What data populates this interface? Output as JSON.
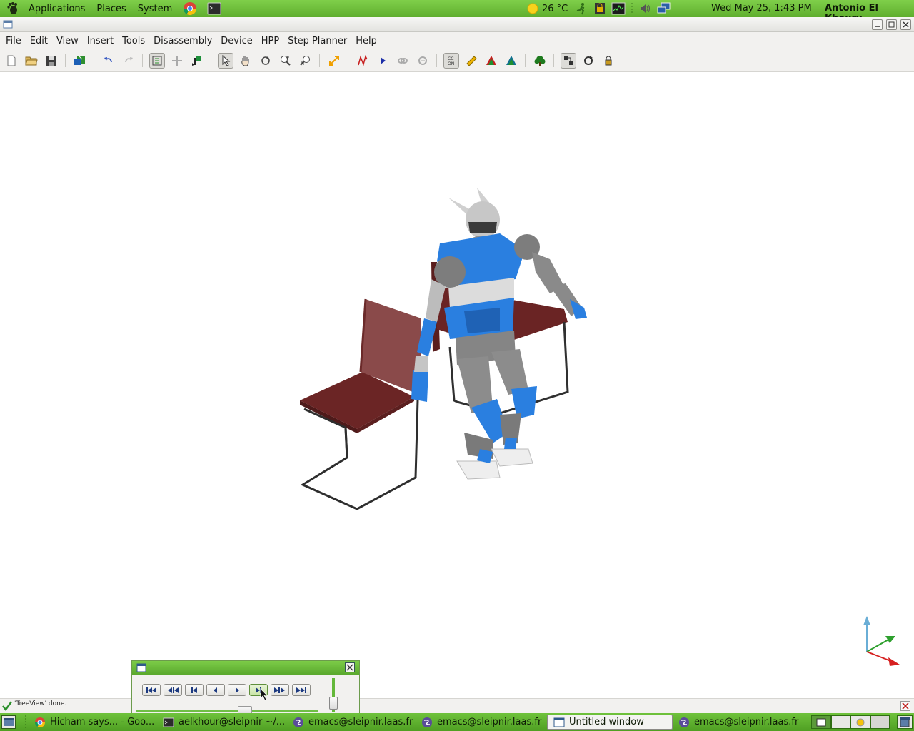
{
  "top_panel": {
    "menus": [
      "Applications",
      "Places",
      "System"
    ],
    "weather": "26 °C",
    "clock": "Wed May 25,  1:43 PM",
    "user": "Antonio El Khoury"
  },
  "menubar": {
    "items": [
      "File",
      "Edit",
      "View",
      "Insert",
      "Tools",
      "Disassembly",
      "Device",
      "HPP",
      "Step Planner",
      "Help"
    ]
  },
  "toolbar": {
    "icons": [
      "new-icon",
      "open-icon",
      "save-icon",
      "import-icon",
      "undo-icon",
      "redo-icon",
      "tree-view-icon",
      "move-icon",
      "transfer-icon",
      "select-icon",
      "pan-icon",
      "rotate-icon",
      "zoom-icon",
      "zoom-fit-icon",
      "arrow-icon",
      "path-icon",
      "play-icon",
      "link-icon",
      "link-2-icon",
      "collision-icon",
      "ruler-icon",
      "planner-red-icon",
      "planner-teal-icon",
      "tree-icon",
      "map-icon",
      "refresh-icon",
      "lock-icon"
    ]
  },
  "status": {
    "message": "'TreeView' done."
  },
  "player": {
    "buttons": [
      "first-frame",
      "step-back-fast",
      "prev-keyframe",
      "play-backward",
      "play-forward",
      "next-keyframe",
      "step-forward-fast",
      "last-frame"
    ],
    "slider_position": 0.6
  },
  "taskbar": {
    "tasks": [
      {
        "label": "Hicham says... - Goo..."
      },
      {
        "label": "aelkhour@sleipnir ~/..."
      },
      {
        "label": "emacs@sleipnir.laas.fr"
      },
      {
        "label": "emacs@sleipnir.laas.fr"
      },
      {
        "label": "Untitled window"
      },
      {
        "label": "emacs@sleipnir.laas.fr"
      }
    ]
  },
  "colors": {
    "panel_green": "#6fc23c",
    "robot_blue": "#2a7fe0",
    "robot_gray": "#7d7d7d",
    "chair_red": "#7a2a2a"
  }
}
